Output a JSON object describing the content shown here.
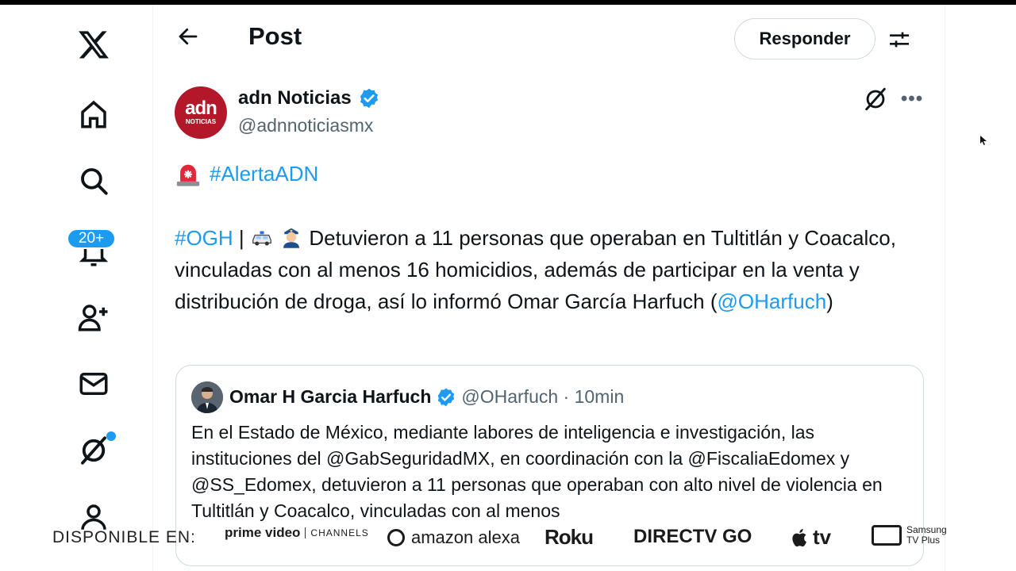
{
  "header": {
    "title": "Post",
    "reply_label": "Responder"
  },
  "nav": {
    "notifications_badge": "20+"
  },
  "post": {
    "author_name": "adn Noticias",
    "author_handle": "@adnnoticiasmx",
    "avatar_text_top": "adn",
    "avatar_text_bottom": "NOTICIAS",
    "hashtag_alert": "#AlertaADN",
    "hashtag_ogh": "#OGH",
    "body_main": " Detuvieron a 11 personas que operaban en Tultitlán y Coacalco, vinculadas con al menos 16 homicidios, además de participar en la venta y distribución de droga, así lo informó Omar García Harfuch (",
    "mention": "@OHarfuch",
    "body_end": ")"
  },
  "quote": {
    "author_name": "Omar H Garcia Harfuch",
    "author_meta": "@OHarfuch · 10min",
    "text": "En el Estado de México, mediante labores de inteligencia e investigación, las instituciones del @GabSeguridadMX, en coordinación con la @FiscaliaEdomex y @SS_Edomex, detuvieron a 11 personas que operaban con alto nivel de violencia en Tultitlán y Coacalco, vinculadas con al menos"
  },
  "ticker": {
    "label": "DISPONIBLE EN:",
    "prime": "prime video",
    "prime_sub": "CHANNELS",
    "alexa": "amazon alexa",
    "roku": "Roku",
    "directv": "DIRECTV GO",
    "appletv": "tv",
    "samsung_line1": "Samsung",
    "samsung_line2": "TV Plus"
  },
  "colors": {
    "accent": "#1d9bf0",
    "text": "#0f1419",
    "muted": "#536471",
    "avatar_brand": "#b3182a"
  }
}
